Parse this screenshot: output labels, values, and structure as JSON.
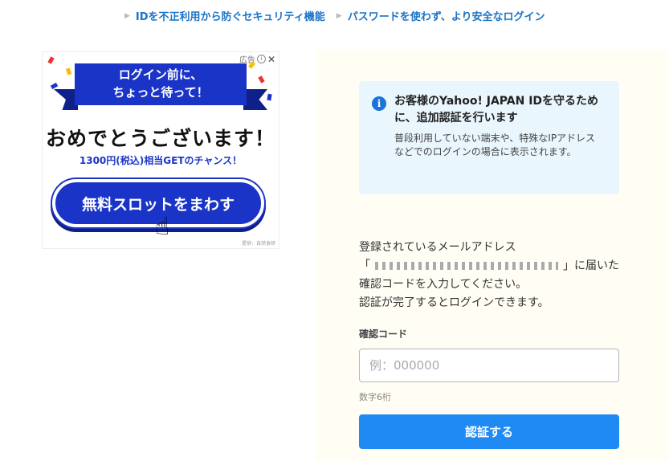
{
  "top_links": [
    {
      "label": "IDを不正利用から防ぐセキュリティ機能"
    },
    {
      "label": "パスワードを使わず、より安全なログイン"
    }
  ],
  "ad": {
    "label": "広告",
    "close": "✕",
    "ribbon_line1": "ログイン前に、",
    "ribbon_line2": "ちょっと待って！",
    "headline": "おめでとうございます！",
    "subline": "1300円(税込)相当GETのチャンス！",
    "button": "無料スロットをまわす",
    "footer": "提供：自然食研"
  },
  "info": {
    "title": "お客様のYahoo! JAPAN IDを守るために、追加認証を行います",
    "text": "普段利用していない端末や、特殊なIPアドレスなどでのログインの場合に表示されます。"
  },
  "desc": {
    "line1": "登録されているメールアドレス",
    "open_quote": "「",
    "close_quote": "」に届いた",
    "line3": "確認コードを入力してください。",
    "line4": "認証が完了するとログインできます。"
  },
  "form": {
    "label": "確認コード",
    "placeholder": "例：000000",
    "hint": "数字6桁",
    "submit": "認証する"
  },
  "colors": {
    "accent": "#1f8af3",
    "link": "#1a73c7",
    "info_bg": "#e9f6fd",
    "ad_blue": "#1b34c8"
  }
}
